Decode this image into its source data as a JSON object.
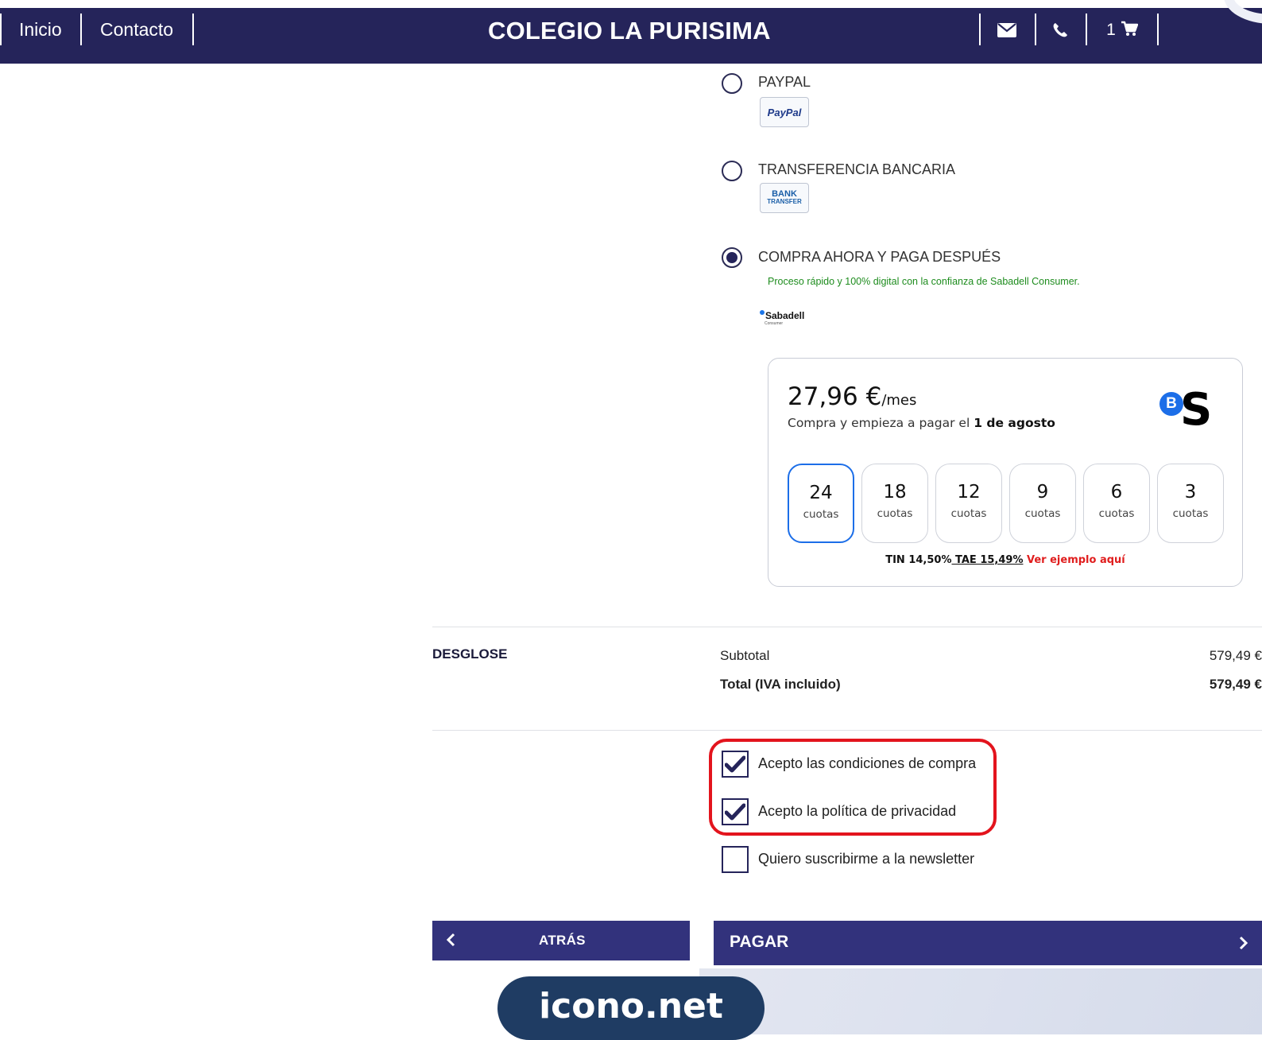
{
  "header": {
    "nav": [
      {
        "label": "Inicio"
      },
      {
        "label": "Contacto"
      }
    ],
    "title": "COLEGIO LA PURISIMA",
    "cart_count": "1",
    "icons": [
      "envelope-icon",
      "phone-icon",
      "cart-icon"
    ]
  },
  "payment_methods": [
    {
      "label": "PAYPAL",
      "logo_text": "PayPal",
      "selected": false
    },
    {
      "label": "TRANSFERENCIA BANCARIA",
      "logo_text": [
        "BANK",
        "TRANSFER"
      ],
      "selected": false
    },
    {
      "label": "COMPRA AHORA Y PAGA DESPUÉS",
      "selected": true,
      "note": "Proceso rápido y 100% digital con la confianza de Sabadell Consumer.",
      "logo_text": "Sabadell",
      "logo_subtext": "Consumer"
    }
  ],
  "financing": {
    "amount": "27,96 €",
    "unit": "/mes",
    "start_text": "Compra y empieza a pagar el ",
    "start_date": "1 de agosto",
    "logo_letter_b": "B",
    "logo_letter_s": "S",
    "installments": [
      {
        "n": "24",
        "label": "cuotas",
        "selected": true
      },
      {
        "n": "18",
        "label": "cuotas",
        "selected": false
      },
      {
        "n": "12",
        "label": "cuotas",
        "selected": false
      },
      {
        "n": "9",
        "label": "cuotas",
        "selected": false
      },
      {
        "n": "6",
        "label": "cuotas",
        "selected": false
      },
      {
        "n": "3",
        "label": "cuotas",
        "selected": false
      }
    ],
    "tin": "TIN 14,50%",
    "tae": " TAE 15,49%",
    "example_link": "Ver ejemplo aquí"
  },
  "breakdown": {
    "title": "DESGLOSE",
    "rows": [
      {
        "label": "Subtotal",
        "value": "579,49 €"
      },
      {
        "label": "Total (IVA incluido)",
        "value": "579,49 €"
      }
    ]
  },
  "consents": [
    {
      "label": "Acepto las condiciones de compra",
      "checked": true
    },
    {
      "label": "Acepto la política de privacidad",
      "checked": true
    },
    {
      "label": "Quiero suscribirme a la newsletter",
      "checked": false
    }
  ],
  "buttons": {
    "back": "ATRÁS",
    "pay": "PAGAR"
  },
  "watermark": "icono.net",
  "colors": {
    "header_bg": "#25245a",
    "button_bg": "#32327c",
    "accent_blue": "#1c6ee8",
    "note_green": "#1e8c1e",
    "link_red": "#e01d1d",
    "highlight_red": "#e3141d"
  }
}
